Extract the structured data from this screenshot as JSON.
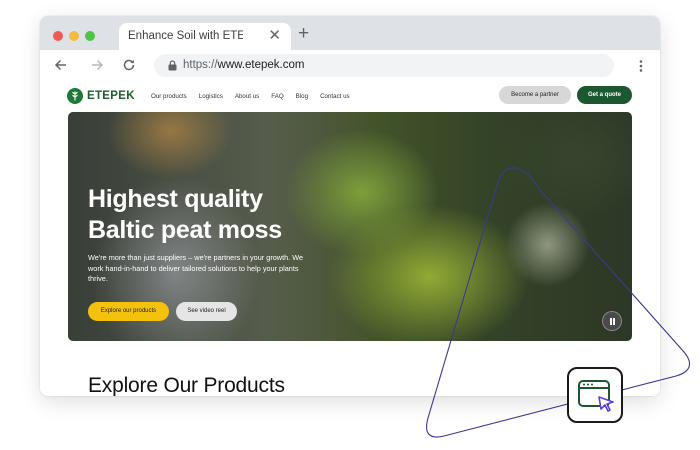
{
  "browser": {
    "tab_title": "Enhance Soil with ETEPEK",
    "new_tab_label": "+",
    "close_label": "✕",
    "url_protocol": "https://",
    "url_domain": "www.etepek.com"
  },
  "site": {
    "logo_text": "ETEPEK",
    "nav": [
      "Our products",
      "Logistics",
      "About us",
      "FAQ",
      "Blog",
      "Contact us"
    ],
    "partner_button": "Become a partner",
    "quote_button": "Get a quote",
    "hero": {
      "title_line1": "Highest quality",
      "title_line2": "Baltic peat moss",
      "description": "We're more than just suppliers – we're partners in your growth. We work hand-in-hand to deliver tailored solutions to help your plants thrive.",
      "explore_button": "Explore our products",
      "video_button": "See video reel"
    },
    "products_heading": "Explore Our Products"
  },
  "colors": {
    "brand_green": "#1b5830",
    "accent_yellow": "#f4c20d",
    "triangle_stroke": "#3b3a8c"
  },
  "icons": [
    "back-arrow-icon",
    "forward-arrow-icon",
    "reload-icon",
    "lock-icon",
    "menu-kebab-icon",
    "leaf-logo-icon",
    "pause-icon",
    "browser-cursor-icon"
  ]
}
